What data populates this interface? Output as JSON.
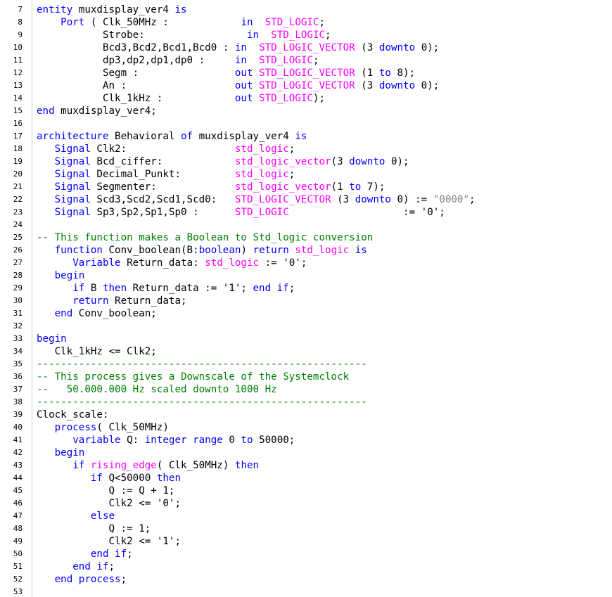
{
  "colors": {
    "keyword": "#0000ff",
    "type": "#ff00ff",
    "comment": "#008000",
    "string": "#808080",
    "text": "#000000",
    "background": "#ffffff"
  },
  "lines": [
    {
      "n": "7",
      "t": [
        [
          "kw",
          "entity"
        ],
        [
          "tx",
          " muxdisplay_ver4 "
        ],
        [
          "kw",
          "is"
        ]
      ]
    },
    {
      "n": "8",
      "t": [
        [
          "tx",
          "    "
        ],
        [
          "kw",
          "Port"
        ],
        [
          "tx",
          " ( Clk_50MHz :            "
        ],
        [
          "kw",
          "in"
        ],
        [
          "tx",
          "  "
        ],
        [
          "ty",
          "STD_LOGIC"
        ],
        [
          "tx",
          ";"
        ]
      ]
    },
    {
      "n": "9",
      "t": [
        [
          "tx",
          "           Strobe:                 "
        ],
        [
          "kw",
          "in"
        ],
        [
          "tx",
          "  "
        ],
        [
          "ty",
          "STD_LOGIC"
        ],
        [
          "tx",
          ";"
        ]
      ]
    },
    {
      "n": "10",
      "t": [
        [
          "tx",
          "           Bcd3,Bcd2,Bcd1,Bcd0 : "
        ],
        [
          "kw",
          "in"
        ],
        [
          "tx",
          "  "
        ],
        [
          "ty",
          "STD_LOGIC_VECTOR"
        ],
        [
          "tx",
          " (3 "
        ],
        [
          "kw",
          "downto"
        ],
        [
          "tx",
          " 0);"
        ]
      ]
    },
    {
      "n": "11",
      "t": [
        [
          "tx",
          "           dp3,dp2,dp1,dp0 :     "
        ],
        [
          "kw",
          "in"
        ],
        [
          "tx",
          "  "
        ],
        [
          "ty",
          "STD_LOGIC"
        ],
        [
          "tx",
          ";"
        ]
      ]
    },
    {
      "n": "12",
      "t": [
        [
          "tx",
          "           Segm :                "
        ],
        [
          "kw",
          "out"
        ],
        [
          "tx",
          " "
        ],
        [
          "ty",
          "STD_LOGIC_VECTOR"
        ],
        [
          "tx",
          " (1 "
        ],
        [
          "kw",
          "to"
        ],
        [
          "tx",
          " 8);"
        ]
      ]
    },
    {
      "n": "13",
      "t": [
        [
          "tx",
          "           An :                  "
        ],
        [
          "kw",
          "out"
        ],
        [
          "tx",
          " "
        ],
        [
          "ty",
          "STD_LOGIC_VECTOR"
        ],
        [
          "tx",
          " (3 "
        ],
        [
          "kw",
          "downto"
        ],
        [
          "tx",
          " 0);"
        ]
      ]
    },
    {
      "n": "14",
      "t": [
        [
          "tx",
          "           Clk_1kHz :            "
        ],
        [
          "kw",
          "out"
        ],
        [
          "tx",
          " "
        ],
        [
          "ty",
          "STD_LOGIC"
        ],
        [
          "tx",
          ");"
        ]
      ]
    },
    {
      "n": "15",
      "t": [
        [
          "kw",
          "end"
        ],
        [
          "tx",
          " muxdisplay_ver4;"
        ]
      ]
    },
    {
      "n": "16",
      "t": []
    },
    {
      "n": "17",
      "t": [
        [
          "kw",
          "architecture"
        ],
        [
          "tx",
          " Behavioral "
        ],
        [
          "kw",
          "of"
        ],
        [
          "tx",
          " muxdisplay_ver4 "
        ],
        [
          "kw",
          "is"
        ]
      ]
    },
    {
      "n": "18",
      "t": [
        [
          "tx",
          "   "
        ],
        [
          "kw",
          "Signal"
        ],
        [
          "tx",
          " Clk2:                  "
        ],
        [
          "ty",
          "std_logic"
        ],
        [
          "tx",
          ";"
        ]
      ]
    },
    {
      "n": "19",
      "t": [
        [
          "tx",
          "   "
        ],
        [
          "kw",
          "Signal"
        ],
        [
          "tx",
          " Bcd_ciffer:            "
        ],
        [
          "ty",
          "std_logic_vector"
        ],
        [
          "tx",
          "(3 "
        ],
        [
          "kw",
          "downto"
        ],
        [
          "tx",
          " 0);"
        ]
      ]
    },
    {
      "n": "20",
      "t": [
        [
          "tx",
          "   "
        ],
        [
          "kw",
          "Signal"
        ],
        [
          "tx",
          " Decimal_Punkt:         "
        ],
        [
          "ty",
          "std_logic"
        ],
        [
          "tx",
          ";"
        ]
      ]
    },
    {
      "n": "21",
      "t": [
        [
          "tx",
          "   "
        ],
        [
          "kw",
          "Signal"
        ],
        [
          "tx",
          " Segmenter:             "
        ],
        [
          "ty",
          "std_logic_vector"
        ],
        [
          "tx",
          "(1 "
        ],
        [
          "kw",
          "to"
        ],
        [
          "tx",
          " 7);"
        ]
      ]
    },
    {
      "n": "22",
      "t": [
        [
          "tx",
          "   "
        ],
        [
          "kw",
          "Signal"
        ],
        [
          "tx",
          " Scd3,Scd2,Scd1,Scd0:   "
        ],
        [
          "ty",
          "STD_LOGIC_VECTOR"
        ],
        [
          "tx",
          " (3 "
        ],
        [
          "kw",
          "downto"
        ],
        [
          "tx",
          " 0) := "
        ],
        [
          "st",
          "\"0000\""
        ],
        [
          "tx",
          ";"
        ]
      ]
    },
    {
      "n": "23",
      "t": [
        [
          "tx",
          "   "
        ],
        [
          "kw",
          "Signal"
        ],
        [
          "tx",
          " Sp3,Sp2,Sp1,Sp0 :      "
        ],
        [
          "ty",
          "STD_LOGIC"
        ],
        [
          "tx",
          "                   := '0';"
        ]
      ]
    },
    {
      "n": "24",
      "t": []
    },
    {
      "n": "25",
      "t": [
        [
          "cm",
          "-- This function makes a Boolean to Std_logic conversion"
        ]
      ]
    },
    {
      "n": "26",
      "t": [
        [
          "tx",
          "   "
        ],
        [
          "kw",
          "function"
        ],
        [
          "tx",
          " Conv_boolean(B:"
        ],
        [
          "kw",
          "boolean"
        ],
        [
          "tx",
          ") "
        ],
        [
          "kw",
          "return"
        ],
        [
          "tx",
          " "
        ],
        [
          "ty",
          "std_logic"
        ],
        [
          "tx",
          " "
        ],
        [
          "kw",
          "is"
        ]
      ]
    },
    {
      "n": "27",
      "t": [
        [
          "tx",
          "      "
        ],
        [
          "kw",
          "Variable"
        ],
        [
          "tx",
          " Return_data: "
        ],
        [
          "ty",
          "std_logic"
        ],
        [
          "tx",
          " := '0';"
        ]
      ]
    },
    {
      "n": "28",
      "t": [
        [
          "tx",
          "   "
        ],
        [
          "kw",
          "begin"
        ]
      ]
    },
    {
      "n": "29",
      "t": [
        [
          "tx",
          "      "
        ],
        [
          "kw",
          "if"
        ],
        [
          "tx",
          " B "
        ],
        [
          "kw",
          "then"
        ],
        [
          "tx",
          " Return_data := '1'; "
        ],
        [
          "kw",
          "end if"
        ],
        [
          "tx",
          ";"
        ]
      ]
    },
    {
      "n": "30",
      "t": [
        [
          "tx",
          "      "
        ],
        [
          "kw",
          "return"
        ],
        [
          "tx",
          " Return_data;"
        ]
      ]
    },
    {
      "n": "31",
      "t": [
        [
          "tx",
          "   "
        ],
        [
          "kw",
          "end"
        ],
        [
          "tx",
          " Conv_boolean;"
        ]
      ]
    },
    {
      "n": "32",
      "t": []
    },
    {
      "n": "33",
      "t": [
        [
          "kw",
          "begin"
        ]
      ]
    },
    {
      "n": "34",
      "t": [
        [
          "tx",
          "   Clk_1kHz <= Clk2;"
        ]
      ]
    },
    {
      "n": "35",
      "t": [
        [
          "cm",
          "-------------------------------------------------------"
        ]
      ]
    },
    {
      "n": "36",
      "t": [
        [
          "cm",
          "-- This process gives a Downscale of the Systemclock"
        ]
      ]
    },
    {
      "n": "37",
      "t": [
        [
          "cm",
          "--   50.000.000 Hz scaled downto 1000 Hz"
        ]
      ]
    },
    {
      "n": "38",
      "t": [
        [
          "cm",
          "-------------------------------------------------------"
        ]
      ]
    },
    {
      "n": "39",
      "t": [
        [
          "tx",
          "Clock_scale:"
        ]
      ]
    },
    {
      "n": "40",
      "t": [
        [
          "tx",
          "   "
        ],
        [
          "kw",
          "process"
        ],
        [
          "tx",
          "( Clk_50MHz)"
        ]
      ]
    },
    {
      "n": "41",
      "t": [
        [
          "tx",
          "      "
        ],
        [
          "kw",
          "variable"
        ],
        [
          "tx",
          " Q: "
        ],
        [
          "kw",
          "integer range"
        ],
        [
          "tx",
          " 0 "
        ],
        [
          "kw",
          "to"
        ],
        [
          "tx",
          " 50000;"
        ]
      ]
    },
    {
      "n": "42",
      "t": [
        [
          "tx",
          "   "
        ],
        [
          "kw",
          "begin"
        ]
      ]
    },
    {
      "n": "43",
      "t": [
        [
          "tx",
          "      "
        ],
        [
          "kw",
          "if"
        ],
        [
          "tx",
          " "
        ],
        [
          "ty",
          "rising_edge"
        ],
        [
          "tx",
          "( Clk_50MHz) "
        ],
        [
          "kw",
          "then"
        ]
      ]
    },
    {
      "n": "44",
      "t": [
        [
          "tx",
          "         "
        ],
        [
          "kw",
          "if"
        ],
        [
          "tx",
          " Q<50000 "
        ],
        [
          "kw",
          "then"
        ]
      ]
    },
    {
      "n": "45",
      "t": [
        [
          "tx",
          "            Q := Q + 1;"
        ]
      ]
    },
    {
      "n": "46",
      "t": [
        [
          "tx",
          "            Clk2 <= '0';"
        ]
      ]
    },
    {
      "n": "47",
      "t": [
        [
          "tx",
          "         "
        ],
        [
          "kw",
          "else"
        ]
      ]
    },
    {
      "n": "48",
      "t": [
        [
          "tx",
          "            Q := 1;"
        ]
      ]
    },
    {
      "n": "49",
      "t": [
        [
          "tx",
          "            Clk2 <= '1';"
        ]
      ]
    },
    {
      "n": "50",
      "t": [
        [
          "tx",
          "         "
        ],
        [
          "kw",
          "end if"
        ],
        [
          "tx",
          ";"
        ]
      ]
    },
    {
      "n": "51",
      "t": [
        [
          "tx",
          "      "
        ],
        [
          "kw",
          "end if"
        ],
        [
          "tx",
          ";"
        ]
      ]
    },
    {
      "n": "52",
      "t": [
        [
          "tx",
          "   "
        ],
        [
          "kw",
          "end process"
        ],
        [
          "tx",
          ";"
        ]
      ]
    },
    {
      "n": "53",
      "t": []
    }
  ]
}
